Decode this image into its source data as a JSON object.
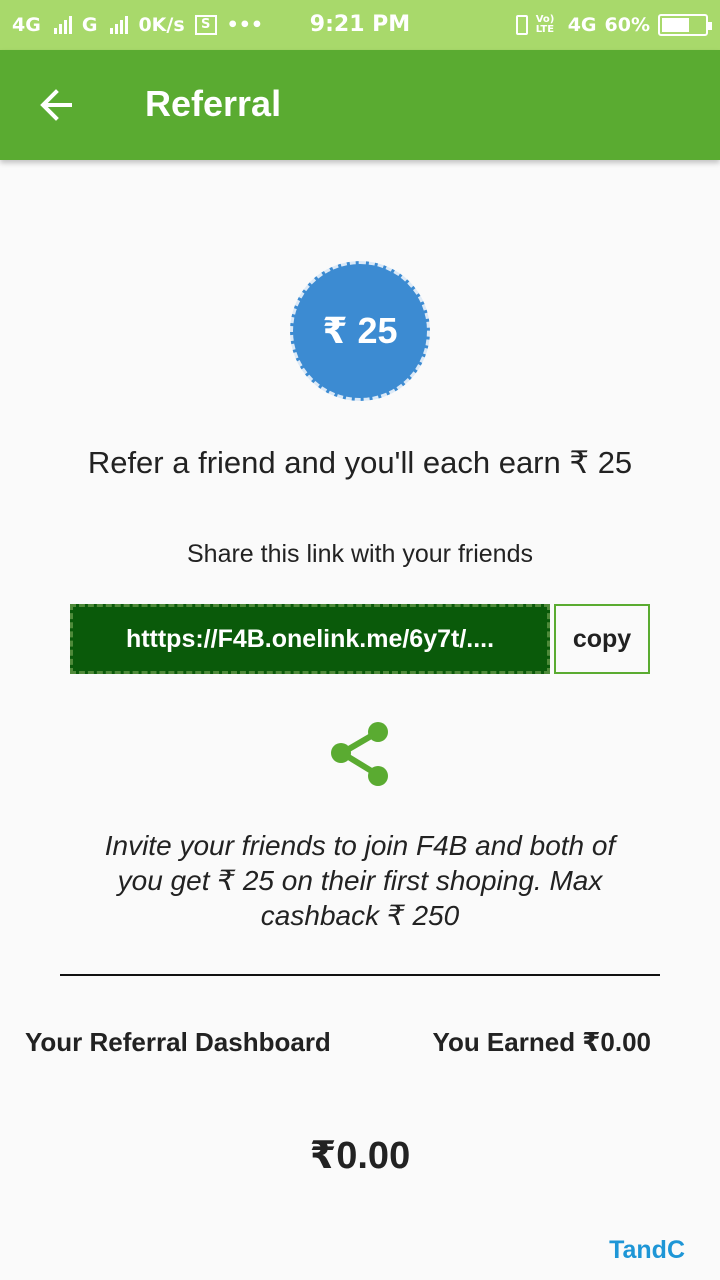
{
  "status_bar": {
    "left_network_1": "4G",
    "left_network_2": "G",
    "data_speed": "0K/s",
    "more": "•••",
    "time": "9:21 PM",
    "volte": "Vo) LTE",
    "network_right": "4G",
    "battery": "60%"
  },
  "header": {
    "title": "Referral",
    "back_icon": "arrow-back-icon"
  },
  "referral": {
    "coin_amount": "₹ 25",
    "headline": "Refer a friend and you'll each earn ₹ 25",
    "share_label": "Share this link with your friends",
    "link": "htttps://F4B.onelink.me/6y7t/....",
    "copy_label": "copy",
    "share_icon": "share-icon",
    "invite_text": "Invite your friends to join F4B and both of you get ₹ 25 on their first shoping. Max cashback ₹ 250"
  },
  "dashboard": {
    "label": "Your Referral Dashboard",
    "earned": "You Earned ₹0.00",
    "amount": "₹0.00"
  },
  "footer": {
    "tandc": "TandC"
  },
  "colors": {
    "status_bar": "#a8d96b",
    "app_bar": "#5aab31",
    "coin": "#3c8bd2",
    "link_box": "#0a5a0a",
    "link_text": "#1e96d6"
  }
}
